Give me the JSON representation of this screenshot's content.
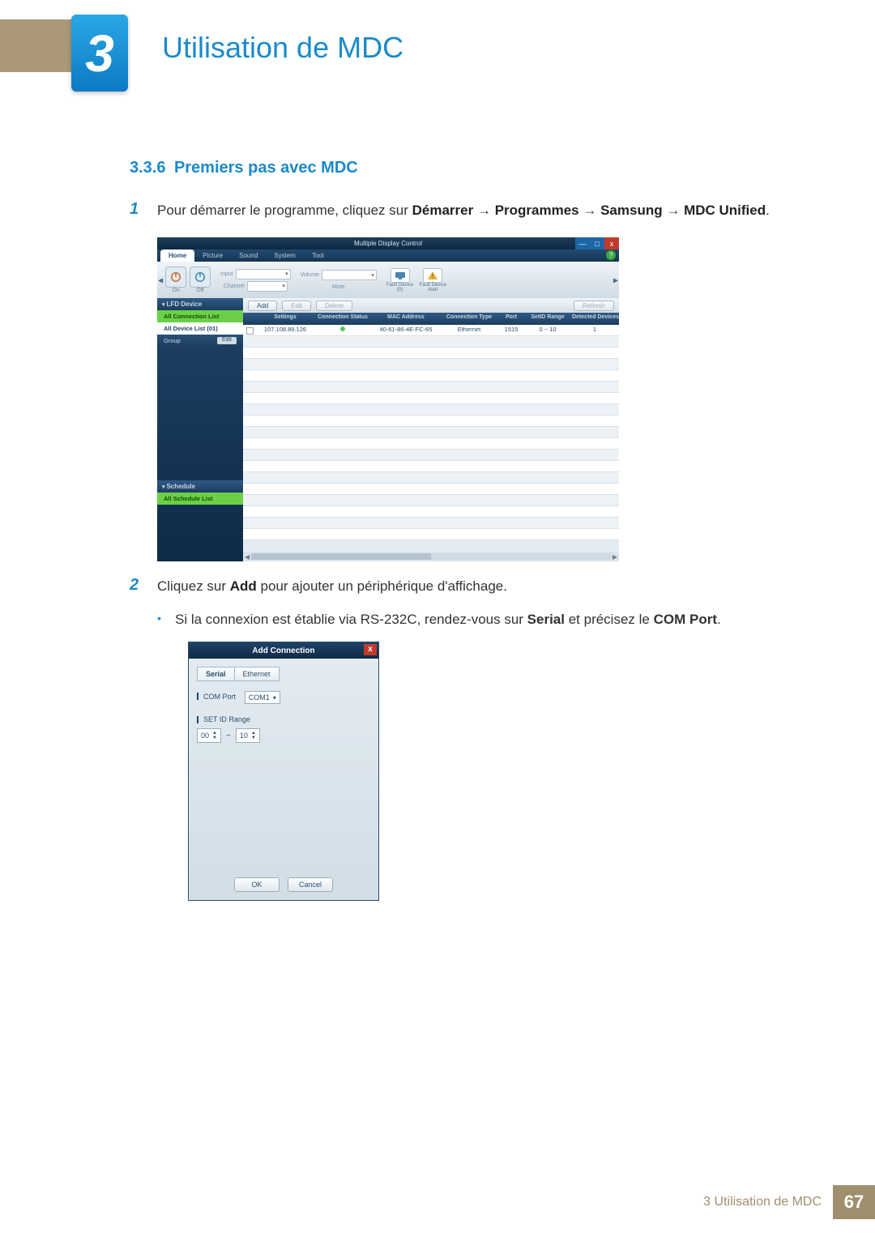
{
  "chapter": {
    "number": "3",
    "title": "Utilisation de MDC"
  },
  "section": {
    "number": "3.3.6",
    "title": "Premiers pas avec MDC"
  },
  "step1": {
    "num": "1",
    "pre": "Pour démarrer le programme, cliquez sur ",
    "b1": "Démarrer",
    "a1": " → ",
    "b2": "Programmes",
    "a2": " → ",
    "b3": "Samsung",
    "a3": " → ",
    "b4": "MDC Unified",
    "post": "."
  },
  "step2": {
    "num": "2",
    "pre": "Cliquez sur ",
    "b1": "Add",
    "post": " pour ajouter un périphérique d'affichage."
  },
  "bullet1": {
    "pre": "Si la connexion est établie via RS-232C, rendez-vous sur ",
    "b1": "Serial",
    "mid": " et précisez le ",
    "b2": "COM Port",
    "post": "."
  },
  "mdc": {
    "title": "Multiple Display Control",
    "help": "?",
    "win": {
      "min": "—",
      "max": "□",
      "close": "x"
    },
    "tabs": {
      "home": "Home",
      "picture": "Picture",
      "sound": "Sound",
      "system": "System",
      "tool": "Tool"
    },
    "ribbon": {
      "on": "On",
      "off": "Off",
      "input_lbl": "Input",
      "input_ph": "",
      "channel_lbl": "Channel",
      "volume_lbl": "Volume",
      "volume_ph": "",
      "mute": "Mute",
      "fault_device": "Fault Device",
      "fault_count": "(0)",
      "fault_alert": "Fault Device Alert"
    },
    "sidebar": {
      "lfd": "LFD Device",
      "all_conn": "All Connection List",
      "all_dev": "All Device List (01)",
      "group": "Group",
      "edit": "Edit",
      "schedule": "Schedule",
      "all_sched": "All Schedule List"
    },
    "toolbar": {
      "add": "Add",
      "edit": "Edit",
      "delete": "Delete",
      "refresh": "Refresh"
    },
    "grid": {
      "h": {
        "chk": "",
        "set": "Settings",
        "stat": "Connection Status",
        "mac": "MAC Address",
        "ctype": "Connection Type",
        "port": "Port",
        "rng": "SetID Range",
        "det": "Detected Devices"
      },
      "row": {
        "set": "107.108.89.126",
        "mac": "40-61-86-4E-FC-65",
        "ctype": "Ethernet",
        "port": "1515",
        "rng": "0 ~ 10",
        "det": "1"
      }
    }
  },
  "dialog": {
    "title": "Add Connection",
    "tabs": {
      "serial": "Serial",
      "ethernet": "Ethernet"
    },
    "com_label": "COM Port",
    "com_value": "COM1",
    "range_label": "SET ID Range",
    "range_from": "00",
    "range_to": "10",
    "range_sep": "~",
    "ok": "OK",
    "cancel": "Cancel"
  },
  "footer": {
    "text": "3  Utilisation de MDC",
    "page": "67"
  }
}
